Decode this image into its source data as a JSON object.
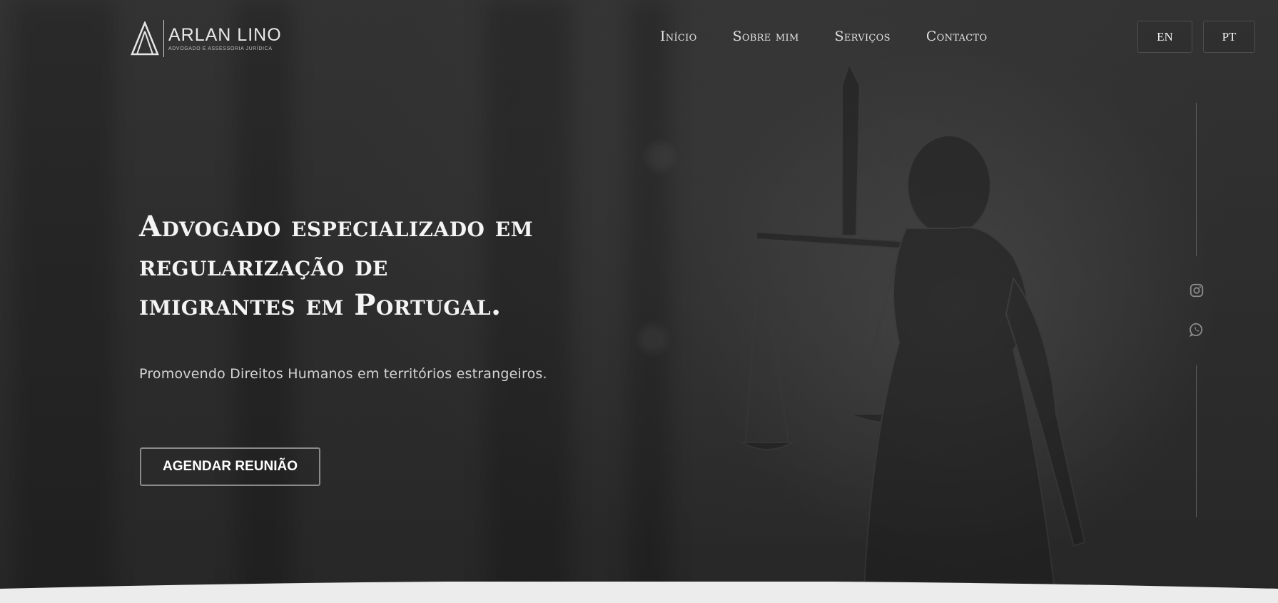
{
  "brand": {
    "name": "ARLAN LINO",
    "tagline": "ADVOGADO E ASSESSORIA JURÍDICA",
    "logo_icon": "triangle-a-logo-icon"
  },
  "nav": {
    "items": [
      {
        "label": "Início"
      },
      {
        "label": "Sobre mim"
      },
      {
        "label": "Serviços"
      },
      {
        "label": "Contacto"
      }
    ]
  },
  "languages": {
    "en": "EN",
    "pt": "PT"
  },
  "hero": {
    "headline_lines": [
      "Advogado especializado em",
      "regularização de",
      "imigrantes em Portugal."
    ],
    "subtitle": "Promovendo Direitos Humanos em territórios estrangeiros.",
    "cta_label": "AGENDAR REUNIÃO"
  },
  "social": {
    "instagram_icon": "instagram-icon",
    "whatsapp_icon": "whatsapp-icon"
  },
  "colors": {
    "background": "#2b2b2b",
    "text": "#f4f4f4",
    "muted_text": "#d4d4d4",
    "border": "#8a8a8a"
  }
}
